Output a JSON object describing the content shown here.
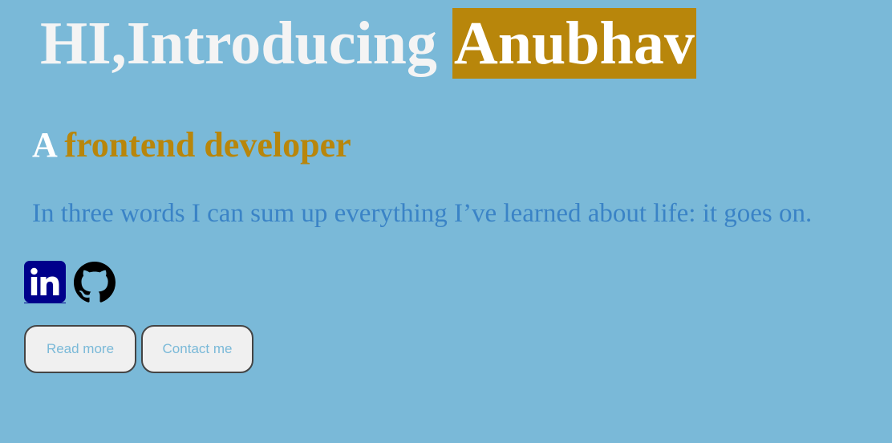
{
  "hero": {
    "greeting": "HI,Introducing ",
    "name": "Anubhav"
  },
  "subtitle": {
    "prefix": "A ",
    "role": "frontend developer"
  },
  "quote": "In three words I can sum up everything I’ve learned about life: it goes on.",
  "social": {
    "links": [
      {
        "icon": "linkedin-icon",
        "color": "#00008b"
      },
      {
        "icon": "github-icon",
        "color": "#000000"
      }
    ]
  },
  "buttons": {
    "read_more": "Read more",
    "contact_me": "Contact me"
  },
  "colors": {
    "background": "#7ab9d8",
    "accent": "#b8860b",
    "quote_text": "#3a83c6"
  }
}
